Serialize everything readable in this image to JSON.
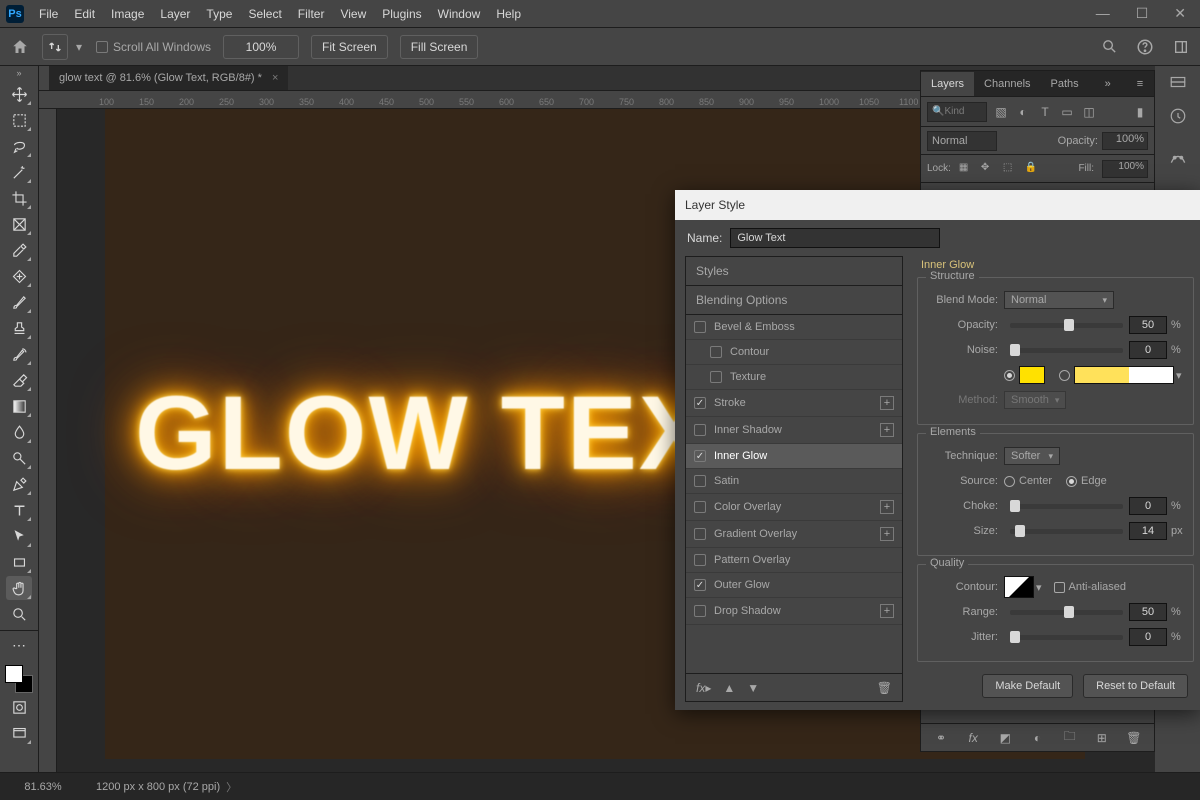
{
  "menu": [
    "File",
    "Edit",
    "Image",
    "Layer",
    "Type",
    "Select",
    "Filter",
    "View",
    "Plugins",
    "Window",
    "Help"
  ],
  "options": {
    "scroll_all_windows": "Scroll All Windows",
    "zoom_pct": "100%",
    "fit_screen": "Fit Screen",
    "fill_screen": "Fill Screen"
  },
  "document": {
    "tab_title": "glow text @ 81.6% (Glow Text, RGB/8#) *",
    "ruler_ticks": [
      "100",
      "150",
      "200",
      "250",
      "300",
      "350",
      "400",
      "450",
      "500",
      "550",
      "600",
      "650",
      "700",
      "750",
      "800",
      "850",
      "900",
      "950",
      "1000",
      "1050",
      "1100"
    ],
    "canvas_text": "GLOW TEXT"
  },
  "status": {
    "zoom": "81.63%",
    "info": "1200 px x 800 px (72 ppi)"
  },
  "layers_panel": {
    "tabs": [
      "Layers",
      "Channels",
      "Paths"
    ],
    "kind_placeholder": "Kind",
    "blend_mode": "Normal",
    "opacity_label": "Opacity:",
    "opacity_value": "100%",
    "lock_label": "Lock:",
    "fill_label": "Fill:",
    "fill_value": "100%"
  },
  "layer_style": {
    "dialog_title": "Layer Style",
    "name_label": "Name:",
    "name_value": "Glow Text",
    "left": {
      "styles_hd": "Styles",
      "blend_opts": "Blending Options",
      "rows": [
        {
          "label": "Bevel & Emboss",
          "checked": false,
          "plus": false
        },
        {
          "label": "Contour",
          "checked": false,
          "plus": false,
          "indent": true
        },
        {
          "label": "Texture",
          "checked": false,
          "plus": false,
          "indent": true
        },
        {
          "label": "Stroke",
          "checked": true,
          "plus": true
        },
        {
          "label": "Inner Shadow",
          "checked": false,
          "plus": true
        },
        {
          "label": "Inner Glow",
          "checked": true,
          "plus": false,
          "sel": true
        },
        {
          "label": "Satin",
          "checked": false,
          "plus": false
        },
        {
          "label": "Color Overlay",
          "checked": false,
          "plus": true
        },
        {
          "label": "Gradient Overlay",
          "checked": false,
          "plus": true
        },
        {
          "label": "Pattern Overlay",
          "checked": false,
          "plus": false
        },
        {
          "label": "Outer Glow",
          "checked": true,
          "plus": false
        },
        {
          "label": "Drop Shadow",
          "checked": false,
          "plus": true
        }
      ]
    },
    "right": {
      "title": "Inner Glow",
      "grp_structure": "Structure",
      "blend_mode_l": "Blend Mode:",
      "blend_mode_v": "Normal",
      "opacity_l": "Opacity:",
      "opacity_v": "50",
      "noise_l": "Noise:",
      "noise_v": "0",
      "method_l": "Method:",
      "method_v": "Smooth",
      "grp_elements": "Elements",
      "technique_l": "Technique:",
      "technique_v": "Softer",
      "source_l": "Source:",
      "source_center": "Center",
      "source_edge": "Edge",
      "choke_l": "Choke:",
      "choke_v": "0",
      "size_l": "Size:",
      "size_v": "14",
      "size_u": "px",
      "grp_quality": "Quality",
      "contour_l": "Contour:",
      "aa": "Anti-aliased",
      "range_l": "Range:",
      "range_v": "50",
      "jitter_l": "Jitter:",
      "jitter_v": "0",
      "pct": "%",
      "make_default": "Make Default",
      "reset_default": "Reset to Default",
      "glow_color": "#ffe100"
    }
  }
}
